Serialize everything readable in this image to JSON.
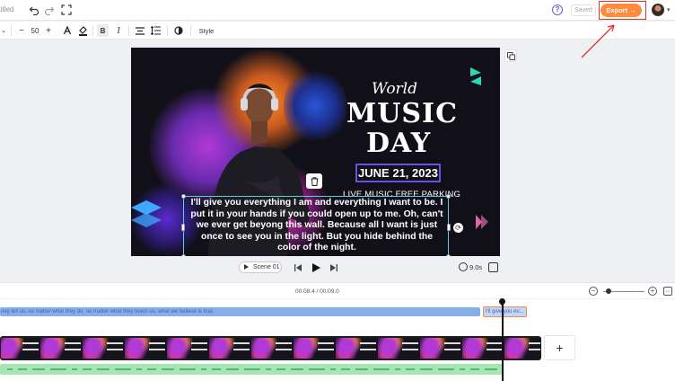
{
  "header": {
    "title": "ntitled",
    "saved_label": "Saved",
    "export_label": "Export →",
    "help_label": "?"
  },
  "format_toolbar": {
    "font_size": "50",
    "minus": "−",
    "plus": "+",
    "bold": "B",
    "italic": "I",
    "style_label": "Style"
  },
  "canvas": {
    "world": "World",
    "music": "MUSIC",
    "day": "DAY",
    "date": "JUNE 21, 2023",
    "parking": "LIVE MUSIC FREE PARKING",
    "caption": "I'll give you everything I am and everything I want to be. I put it in your hands if you could open up to me. Oh, can't we ever get beyong this wall. Because all I want is just once to see you in the light. But you hide behind the color of the night."
  },
  "playback": {
    "scene_label": "Scene 01",
    "duration": "9.0s"
  },
  "timeline": {
    "time_readout": "00:08.4 / 00:09.0",
    "text_clip_1": "ney tell us, no matter what they do, no matter what they teach us, what we believe is true.",
    "text_clip_2": "I'll give you ev...",
    "add_label": "+"
  },
  "colors": {
    "export": "#ff8c3a",
    "annotation": "#e03434",
    "text_track": "#88aee7",
    "audio_track": "#a5e6b3",
    "canvas_bg": "#111019",
    "date_border": "#6f4de6"
  }
}
